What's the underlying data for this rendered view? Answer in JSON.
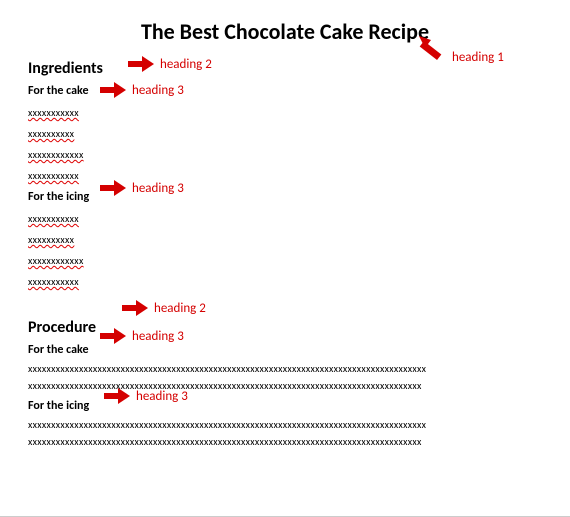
{
  "title": "The Best Chocolate Cake Recipe",
  "sections": {
    "ingredients": {
      "heading": "Ingredients",
      "cake": {
        "heading": "For the cake",
        "lines": [
          "xxxxxxxxxxx",
          "xxxxxxxxxx",
          "xxxxxxxxxxxx",
          "xxxxxxxxxxx"
        ]
      },
      "icing": {
        "heading": "For the icing",
        "lines": [
          "xxxxxxxxxxx",
          "xxxxxxxxxx",
          "xxxxxxxxxxxx",
          "xxxxxxxxxxx"
        ]
      }
    },
    "procedure": {
      "heading": "Procedure",
      "cake": {
        "heading": "For the cake",
        "paras": [
          "xxxxxxxxxxxxxxxxxxxxxxxxxxxxxxxxxxxxxxxxxxxxxxxxxxxxxxxxxxxxxxxxxxxxxxxxxxxxxxxxxxxxxx",
          "xxxxxxxxxxxxxxxxxxxxxxxxxxxxxxxxxxxxxxxxxxxxxxxxxxxxxxxxxxxxxxxxxxxxxxxxxxxxxxxxxxxxx"
        ]
      },
      "icing": {
        "heading": "For the icing",
        "paras": [
          "xxxxxxxxxxxxxxxxxxxxxxxxxxxxxxxxxxxxxxxxxxxxxxxxxxxxxxxxxxxxxxxxxxxxxxxxxxxxxxxxxxxxxx",
          "xxxxxxxxxxxxxxxxxxxxxxxxxxxxxxxxxxxxxxxxxxxxxxxxxxxxxxxxxxxxxxxxxxxxxxxxxxxxxxxxxxxxx"
        ]
      }
    }
  },
  "annotations": {
    "h1": "heading 1",
    "h2": "heading 2",
    "h3": "heading 3"
  }
}
